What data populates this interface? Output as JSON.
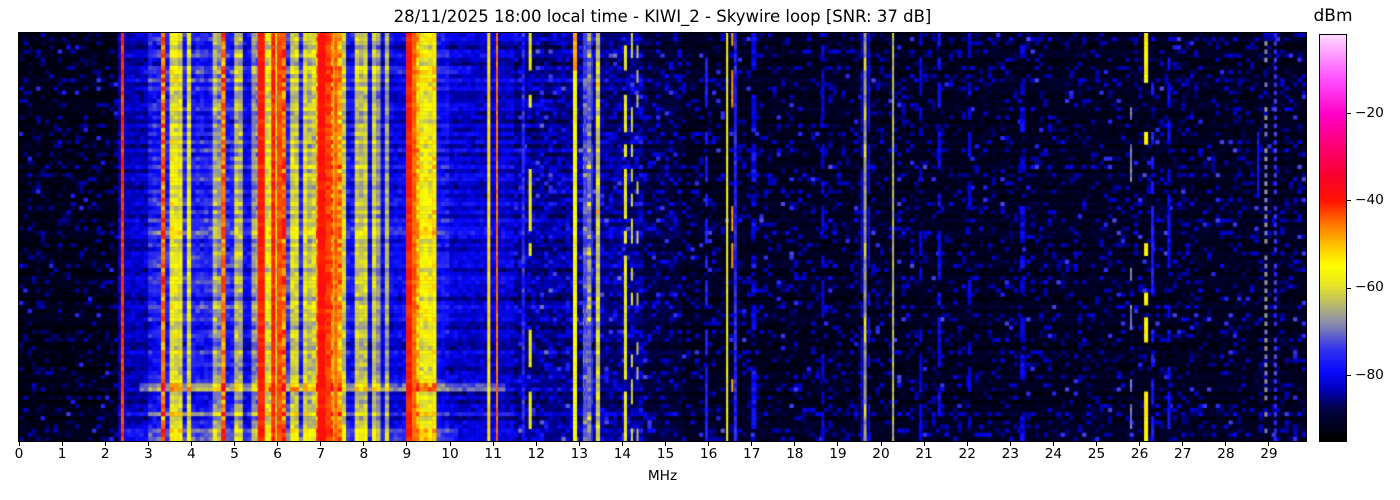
{
  "chart_data": {
    "type": "heatmap",
    "title": "28/11/2025 18:00 local time - KIWI_2 - Skywire loop [SNR: 37 dB]",
    "xlabel": "MHz",
    "colorbar_label": "dBm",
    "x_range_mhz": [
      0,
      29.86
    ],
    "x_ticks": [
      0,
      1,
      2,
      3,
      4,
      5,
      6,
      7,
      8,
      9,
      10,
      11,
      12,
      13,
      14,
      15,
      16,
      17,
      18,
      19,
      20,
      21,
      22,
      23,
      24,
      25,
      26,
      27,
      28,
      29
    ],
    "x_tick_labels": [
      "0",
      "1",
      "2",
      "3",
      "4",
      "5",
      "6",
      "7",
      "8",
      "9",
      "10",
      "11",
      "12",
      "13",
      "14",
      "15",
      "16",
      "17",
      "18",
      "19",
      "20",
      "21",
      "22",
      "23",
      "24",
      "25",
      "26",
      "27",
      "28",
      "29"
    ],
    "colorbar": {
      "vmin": -95,
      "vmax": -2,
      "tick_values": [
        -20,
        -40,
        -60,
        -80
      ],
      "tick_labels": [
        "−20",
        "−40",
        "−60",
        "−80"
      ]
    },
    "colormap_stops": [
      [
        0.0,
        "#000000"
      ],
      [
        0.075,
        "#020240"
      ],
      [
        0.129,
        "#0000c0"
      ],
      [
        0.172,
        "#0a0aff"
      ],
      [
        0.226,
        "#3333ee"
      ],
      [
        0.269,
        "#7070c0"
      ],
      [
        0.301,
        "#9898a0"
      ],
      [
        0.344,
        "#c0c060"
      ],
      [
        0.387,
        "#e8e820"
      ],
      [
        0.43,
        "#ffff00"
      ],
      [
        0.484,
        "#ffc000"
      ],
      [
        0.538,
        "#ff7000"
      ],
      [
        0.591,
        "#ff1400"
      ],
      [
        0.656,
        "#f80030"
      ],
      [
        0.731,
        "#ff0078"
      ],
      [
        0.806,
        "#ff00c8"
      ],
      [
        0.892,
        "#ff50ff"
      ],
      [
        0.957,
        "#ffa0ff"
      ],
      [
        1.0,
        "#ffd8ff"
      ]
    ],
    "freq_bins": 299,
    "time_rows": 99,
    "noise_floor_dbm": -92.5,
    "bands": [
      {
        "f0": 0.0,
        "f1": 2.28,
        "base": -92.5,
        "noise": 1.5,
        "row_factor": 0.3,
        "speckle": 0.22,
        "speckle_amp": 8
      },
      {
        "f0": 2.28,
        "f1": 2.95,
        "base": -83.0,
        "noise": 3.5,
        "row_factor": 0.8,
        "stripes": {
          "density": 0.18,
          "min": -72,
          "max": -56
        }
      },
      {
        "f0": 2.95,
        "f1": 5.15,
        "base": -77.0,
        "noise": 5.0,
        "row_factor": 1.6,
        "stripes": {
          "density": 0.42,
          "min": -66,
          "max": -44
        }
      },
      {
        "f0": 5.15,
        "f1": 5.45,
        "base": -80.0,
        "noise": 4.0,
        "row_factor": 1.2,
        "stripes": {
          "density": 0.2,
          "min": -68,
          "max": -56
        }
      },
      {
        "f0": 5.45,
        "f1": 6.4,
        "base": -75.0,
        "noise": 5.0,
        "row_factor": 1.6,
        "stripes": {
          "density": 0.5,
          "min": -62,
          "max": -39
        }
      },
      {
        "f0": 6.4,
        "f1": 6.95,
        "base": -77.0,
        "noise": 5.0,
        "row_factor": 1.4,
        "stripes": {
          "density": 0.38,
          "min": -64,
          "max": -47
        }
      },
      {
        "f0": 6.95,
        "f1": 7.5,
        "base": -74.0,
        "noise": 5.0,
        "row_factor": 1.6,
        "stripes": {
          "density": 0.55,
          "min": -58,
          "max": -37
        }
      },
      {
        "f0": 7.5,
        "f1": 8.1,
        "base": -79.0,
        "noise": 4.5,
        "row_factor": 1.3,
        "stripes": {
          "density": 0.32,
          "min": -66,
          "max": -50
        }
      },
      {
        "f0": 8.1,
        "f1": 8.95,
        "base": -80.5,
        "noise": 4.0,
        "row_factor": 1.2,
        "stripes": {
          "density": 0.24,
          "min": -68,
          "max": -52
        }
      },
      {
        "f0": 8.95,
        "f1": 9.5,
        "base": -76.0,
        "noise": 5.0,
        "row_factor": 1.4,
        "stripes": {
          "density": 0.5,
          "min": -58,
          "max": -38
        }
      },
      {
        "f0": 9.5,
        "f1": 10.0,
        "base": -79.0,
        "noise": 4.5,
        "row_factor": 1.3,
        "stripes": {
          "density": 0.3,
          "min": -66,
          "max": -52
        }
      },
      {
        "f0": 10.0,
        "f1": 11.45,
        "base": -82.0,
        "noise": 3.5,
        "row_factor": 1.1,
        "stripes": {
          "density": 0.1,
          "min": -72,
          "max": -58
        }
      },
      {
        "f0": 11.45,
        "f1": 13.6,
        "base": -85.5,
        "noise": 3.0,
        "row_factor": 0.8,
        "speckle": 0.3,
        "speckle_amp": 6,
        "stripes": {
          "density": 0.05,
          "min": -74,
          "max": -62
        }
      },
      {
        "f0": 13.6,
        "f1": 14.45,
        "base": -86.0,
        "noise": 3.0,
        "row_factor": 0.7,
        "speckle": 0.3,
        "speckle_amp": 6,
        "stripes": {
          "density": 0.06,
          "min": -72,
          "max": -60
        }
      },
      {
        "f0": 14.45,
        "f1": 15.4,
        "base": -89.0,
        "noise": 2.5,
        "row_factor": 0.5,
        "speckle": 0.25,
        "speckle_amp": 7
      },
      {
        "f0": 15.4,
        "f1": 29.86,
        "base": -91.5,
        "noise": 1.8,
        "row_factor": 0.35,
        "speckle": 0.22,
        "speckle_amp": 8
      }
    ],
    "carriers": [
      {
        "f": 2.4,
        "level": -42,
        "px": 3
      },
      {
        "f": 5.62,
        "level": -40,
        "px": 7
      },
      {
        "f": 5.9,
        "level": -41,
        "px": 4
      },
      {
        "f": 6.05,
        "level": -43,
        "px": 4
      },
      {
        "f": 7.02,
        "level": -39,
        "px": 8
      },
      {
        "f": 7.18,
        "level": -42,
        "px": 5
      },
      {
        "f": 7.35,
        "level": -44,
        "px": 3
      },
      {
        "f": 9.05,
        "level": -40,
        "px": 6
      },
      {
        "f": 9.17,
        "level": -44,
        "px": 4
      },
      {
        "f": 10.9,
        "level": -53,
        "px": 3
      },
      {
        "f": 11.09,
        "level": -45,
        "px": 2
      },
      {
        "f": 11.7,
        "level": -76,
        "px": 3,
        "jitter": 4
      },
      {
        "f": 11.86,
        "level": -58,
        "px": 3,
        "duty": 0.5
      },
      {
        "f": 12.9,
        "level": -55,
        "px": 4
      },
      {
        "f": 12.9,
        "level": -48,
        "px": 4,
        "segments": [
          [
            0,
            8
          ]
        ]
      },
      {
        "f": 13.13,
        "level": -72,
        "px": 2,
        "duty": 0.6
      },
      {
        "f": 13.3,
        "level": -74,
        "px": 2,
        "duty": 0.5
      },
      {
        "f": 14.07,
        "level": -58,
        "px": 3,
        "duty": 0.65
      },
      {
        "f": 14.22,
        "level": -61,
        "px": 2,
        "duty": 0.45
      },
      {
        "f": 14.35,
        "level": -63,
        "px": 2,
        "duty": 0.4
      },
      {
        "f": 15.95,
        "level": -77,
        "px": 3,
        "duty": 0.55
      },
      {
        "f": 16.43,
        "level": -57,
        "px": 2
      },
      {
        "f": 16.55,
        "level": -48,
        "px": 2,
        "duty": 0.22
      },
      {
        "f": 16.62,
        "level": -76,
        "px": 3,
        "jitter": 3
      },
      {
        "f": 17.05,
        "level": -80,
        "px": 5,
        "duty": 0.6,
        "jitter": 4
      },
      {
        "f": 18.65,
        "level": -81,
        "px": 3,
        "duty": 0.5
      },
      {
        "f": 19.55,
        "level": -80,
        "px": 2,
        "duty": 0.75
      },
      {
        "f": 19.63,
        "level": -67,
        "px": 3,
        "jitter": 2.5
      },
      {
        "f": 19.63,
        "level": -58,
        "px": 2,
        "duty": 0.18
      },
      {
        "f": 19.72,
        "level": -80,
        "px": 2,
        "duty": 0.65
      },
      {
        "f": 20.28,
        "level": -64,
        "px": 2,
        "jitter": 3
      },
      {
        "f": 20.92,
        "level": -81,
        "px": 3,
        "duty": 0.5
      },
      {
        "f": 21.35,
        "level": -79,
        "px": 3,
        "duty": 0.55
      },
      {
        "f": 22.05,
        "level": -81,
        "px": 3,
        "duty": 0.5
      },
      {
        "f": 23.28,
        "level": -81,
        "px": 5,
        "duty": 0.6,
        "jitter": 3
      },
      {
        "f": 25.8,
        "level": -69,
        "px": 2,
        "duty": 0.35
      },
      {
        "f": 26.15,
        "level": -55,
        "px": 4,
        "duty": 0.22,
        "segments": [
          [
            0,
            11
          ],
          [
            87,
            98
          ]
        ]
      },
      {
        "f": 26.3,
        "level": -77,
        "px": 3,
        "duty": 0.5
      },
      {
        "f": 26.68,
        "level": -79,
        "px": 3,
        "duty": 0.45
      },
      {
        "f": 28.75,
        "level": -78,
        "px": 2,
        "segments": [
          [
            24,
            39
          ]
        ]
      },
      {
        "f": 28.93,
        "level": -68,
        "px": 3,
        "style": "dot",
        "duty": 0.8
      },
      {
        "f": 29.15,
        "level": -74,
        "px": 3,
        "style": "dot",
        "duty": 0.9
      }
    ],
    "streaks": [
      {
        "row0": 8,
        "row1": 9,
        "f0": 2.8,
        "f1": 10.5,
        "boost": 5.0
      },
      {
        "row0": 47,
        "row1": 48,
        "f0": 2.95,
        "f1": 11.0,
        "boost": 2.5
      },
      {
        "row0": 85,
        "row1": 86,
        "f0": 2.8,
        "f1": 11.3,
        "boost": 9.5
      },
      {
        "row0": 96,
        "row1": 98,
        "f0": 2.4,
        "f1": 10.2,
        "boost": 3.5
      }
    ]
  }
}
